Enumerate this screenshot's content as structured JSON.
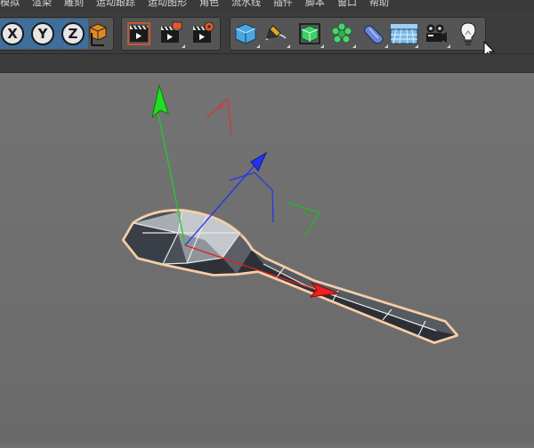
{
  "menu": {
    "items": [
      "模拟",
      "渲染",
      "雕刻",
      "运动跟踪",
      "运动图形",
      "角色",
      "流水线",
      "插件",
      "脚本",
      "窗口",
      "帮助"
    ]
  },
  "toolbar": {
    "axis_x_label": "X",
    "axis_y_label": "Y",
    "axis_z_label": "Z",
    "icons": [
      "lock-x",
      "lock-y",
      "lock-z",
      "coordinate-system",
      "render-view",
      "render-to-picture-viewer",
      "render-settings",
      "cube",
      "pen",
      "subdivision",
      "cloner",
      "deformer",
      "floor",
      "camera",
      "light"
    ]
  },
  "colors": {
    "x_axis": "#e02020",
    "y_axis": "#22cc22",
    "z_axis": "#2233ee",
    "selection_outline": "#f4c9a0",
    "viewport_bg": "#6f6f6f",
    "toolbar_bg": "#3c3c3c"
  }
}
